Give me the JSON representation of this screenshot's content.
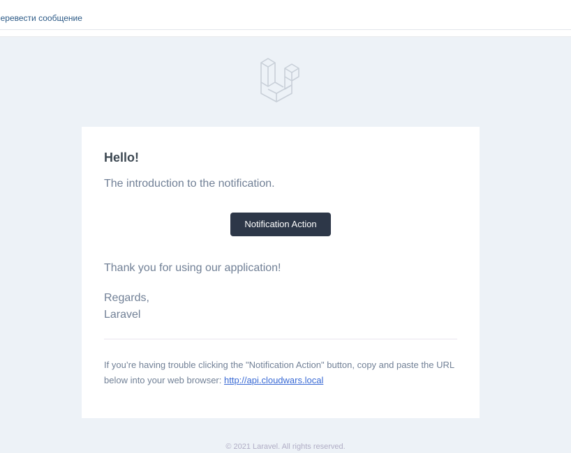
{
  "toolbar": {
    "translate_label": "Перевести сообщение"
  },
  "email": {
    "greeting": "Hello!",
    "intro": "The introduction to the notification.",
    "action_label": "Notification Action",
    "thanks": "Thank you for using our application!",
    "regards": "Regards,",
    "signature": "Laravel",
    "subcopy_text": "If you’re having trouble clicking the \"Notification Action\" button, copy and paste the URL below into your web browser: ",
    "subcopy_url": "http://api.cloudwars.local",
    "footer": "© 2021 Laravel. All rights reserved."
  },
  "icons": {
    "logo": "laravel-logo-icon"
  },
  "colors": {
    "background": "#edf2f7",
    "button": "#2d3748",
    "link": "#3869d4",
    "text": "#718096",
    "heading": "#3d4852"
  }
}
